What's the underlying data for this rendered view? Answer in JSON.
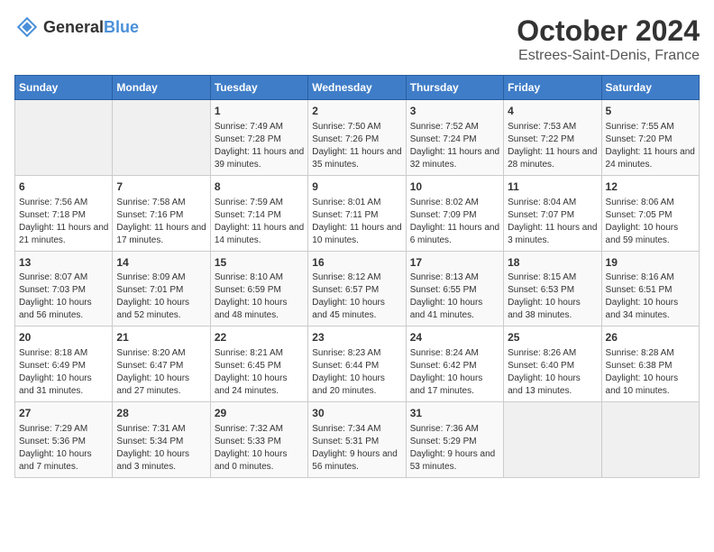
{
  "logo": {
    "general": "General",
    "blue": "Blue"
  },
  "title": "October 2024",
  "subtitle": "Estrees-Saint-Denis, France",
  "headers": [
    "Sunday",
    "Monday",
    "Tuesday",
    "Wednesday",
    "Thursday",
    "Friday",
    "Saturday"
  ],
  "weeks": [
    [
      {
        "day": "",
        "info": ""
      },
      {
        "day": "",
        "info": ""
      },
      {
        "day": "1",
        "info": "Sunrise: 7:49 AM\nSunset: 7:28 PM\nDaylight: 11 hours and 39 minutes."
      },
      {
        "day": "2",
        "info": "Sunrise: 7:50 AM\nSunset: 7:26 PM\nDaylight: 11 hours and 35 minutes."
      },
      {
        "day": "3",
        "info": "Sunrise: 7:52 AM\nSunset: 7:24 PM\nDaylight: 11 hours and 32 minutes."
      },
      {
        "day": "4",
        "info": "Sunrise: 7:53 AM\nSunset: 7:22 PM\nDaylight: 11 hours and 28 minutes."
      },
      {
        "day": "5",
        "info": "Sunrise: 7:55 AM\nSunset: 7:20 PM\nDaylight: 11 hours and 24 minutes."
      }
    ],
    [
      {
        "day": "6",
        "info": "Sunrise: 7:56 AM\nSunset: 7:18 PM\nDaylight: 11 hours and 21 minutes."
      },
      {
        "day": "7",
        "info": "Sunrise: 7:58 AM\nSunset: 7:16 PM\nDaylight: 11 hours and 17 minutes."
      },
      {
        "day": "8",
        "info": "Sunrise: 7:59 AM\nSunset: 7:14 PM\nDaylight: 11 hours and 14 minutes."
      },
      {
        "day": "9",
        "info": "Sunrise: 8:01 AM\nSunset: 7:11 PM\nDaylight: 11 hours and 10 minutes."
      },
      {
        "day": "10",
        "info": "Sunrise: 8:02 AM\nSunset: 7:09 PM\nDaylight: 11 hours and 6 minutes."
      },
      {
        "day": "11",
        "info": "Sunrise: 8:04 AM\nSunset: 7:07 PM\nDaylight: 11 hours and 3 minutes."
      },
      {
        "day": "12",
        "info": "Sunrise: 8:06 AM\nSunset: 7:05 PM\nDaylight: 10 hours and 59 minutes."
      }
    ],
    [
      {
        "day": "13",
        "info": "Sunrise: 8:07 AM\nSunset: 7:03 PM\nDaylight: 10 hours and 56 minutes."
      },
      {
        "day": "14",
        "info": "Sunrise: 8:09 AM\nSunset: 7:01 PM\nDaylight: 10 hours and 52 minutes."
      },
      {
        "day": "15",
        "info": "Sunrise: 8:10 AM\nSunset: 6:59 PM\nDaylight: 10 hours and 48 minutes."
      },
      {
        "day": "16",
        "info": "Sunrise: 8:12 AM\nSunset: 6:57 PM\nDaylight: 10 hours and 45 minutes."
      },
      {
        "day": "17",
        "info": "Sunrise: 8:13 AM\nSunset: 6:55 PM\nDaylight: 10 hours and 41 minutes."
      },
      {
        "day": "18",
        "info": "Sunrise: 8:15 AM\nSunset: 6:53 PM\nDaylight: 10 hours and 38 minutes."
      },
      {
        "day": "19",
        "info": "Sunrise: 8:16 AM\nSunset: 6:51 PM\nDaylight: 10 hours and 34 minutes."
      }
    ],
    [
      {
        "day": "20",
        "info": "Sunrise: 8:18 AM\nSunset: 6:49 PM\nDaylight: 10 hours and 31 minutes."
      },
      {
        "day": "21",
        "info": "Sunrise: 8:20 AM\nSunset: 6:47 PM\nDaylight: 10 hours and 27 minutes."
      },
      {
        "day": "22",
        "info": "Sunrise: 8:21 AM\nSunset: 6:45 PM\nDaylight: 10 hours and 24 minutes."
      },
      {
        "day": "23",
        "info": "Sunrise: 8:23 AM\nSunset: 6:44 PM\nDaylight: 10 hours and 20 minutes."
      },
      {
        "day": "24",
        "info": "Sunrise: 8:24 AM\nSunset: 6:42 PM\nDaylight: 10 hours and 17 minutes."
      },
      {
        "day": "25",
        "info": "Sunrise: 8:26 AM\nSunset: 6:40 PM\nDaylight: 10 hours and 13 minutes."
      },
      {
        "day": "26",
        "info": "Sunrise: 8:28 AM\nSunset: 6:38 PM\nDaylight: 10 hours and 10 minutes."
      }
    ],
    [
      {
        "day": "27",
        "info": "Sunrise: 7:29 AM\nSunset: 5:36 PM\nDaylight: 10 hours and 7 minutes."
      },
      {
        "day": "28",
        "info": "Sunrise: 7:31 AM\nSunset: 5:34 PM\nDaylight: 10 hours and 3 minutes."
      },
      {
        "day": "29",
        "info": "Sunrise: 7:32 AM\nSunset: 5:33 PM\nDaylight: 10 hours and 0 minutes."
      },
      {
        "day": "30",
        "info": "Sunrise: 7:34 AM\nSunset: 5:31 PM\nDaylight: 9 hours and 56 minutes."
      },
      {
        "day": "31",
        "info": "Sunrise: 7:36 AM\nSunset: 5:29 PM\nDaylight: 9 hours and 53 minutes."
      },
      {
        "day": "",
        "info": ""
      },
      {
        "day": "",
        "info": ""
      }
    ]
  ]
}
